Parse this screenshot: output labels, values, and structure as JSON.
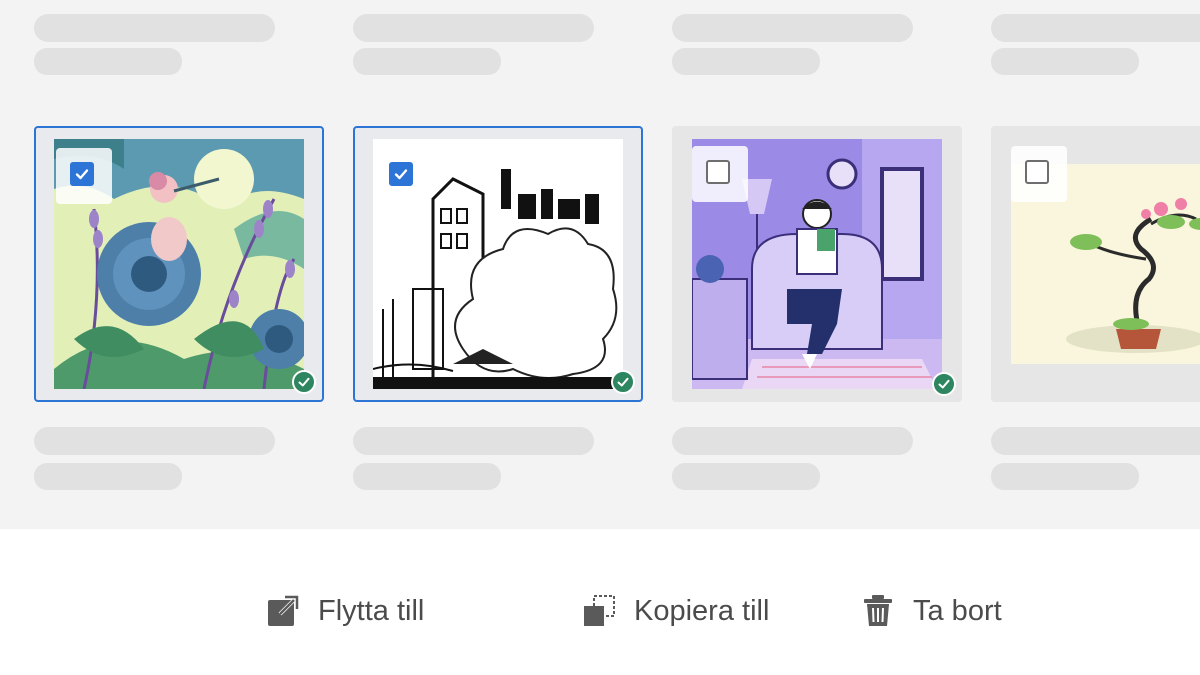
{
  "gallery": {
    "items": [
      {
        "name": "flower-flute-illustration",
        "selected": true,
        "synced": true
      },
      {
        "name": "city-clouds-illustration",
        "selected": true,
        "synced": true
      },
      {
        "name": "reading-room-illustration",
        "selected": false,
        "synced": true
      },
      {
        "name": "bonsai-illustration",
        "selected": false,
        "synced": false
      }
    ]
  },
  "actions": {
    "move_label": "Flytta till",
    "copy_label": "Kopiera till",
    "delete_label": "Ta bort"
  },
  "colors": {
    "accent": "#2c74d6",
    "sync_green": "#2d8660",
    "placeholder": "#e1e1e1",
    "text": "#4b4b4b"
  },
  "icons": {
    "move": "move-to-icon",
    "copy": "copy-to-icon",
    "delete": "trash-icon",
    "checkbox": "checkmark-icon",
    "sync": "sync-check-icon"
  }
}
